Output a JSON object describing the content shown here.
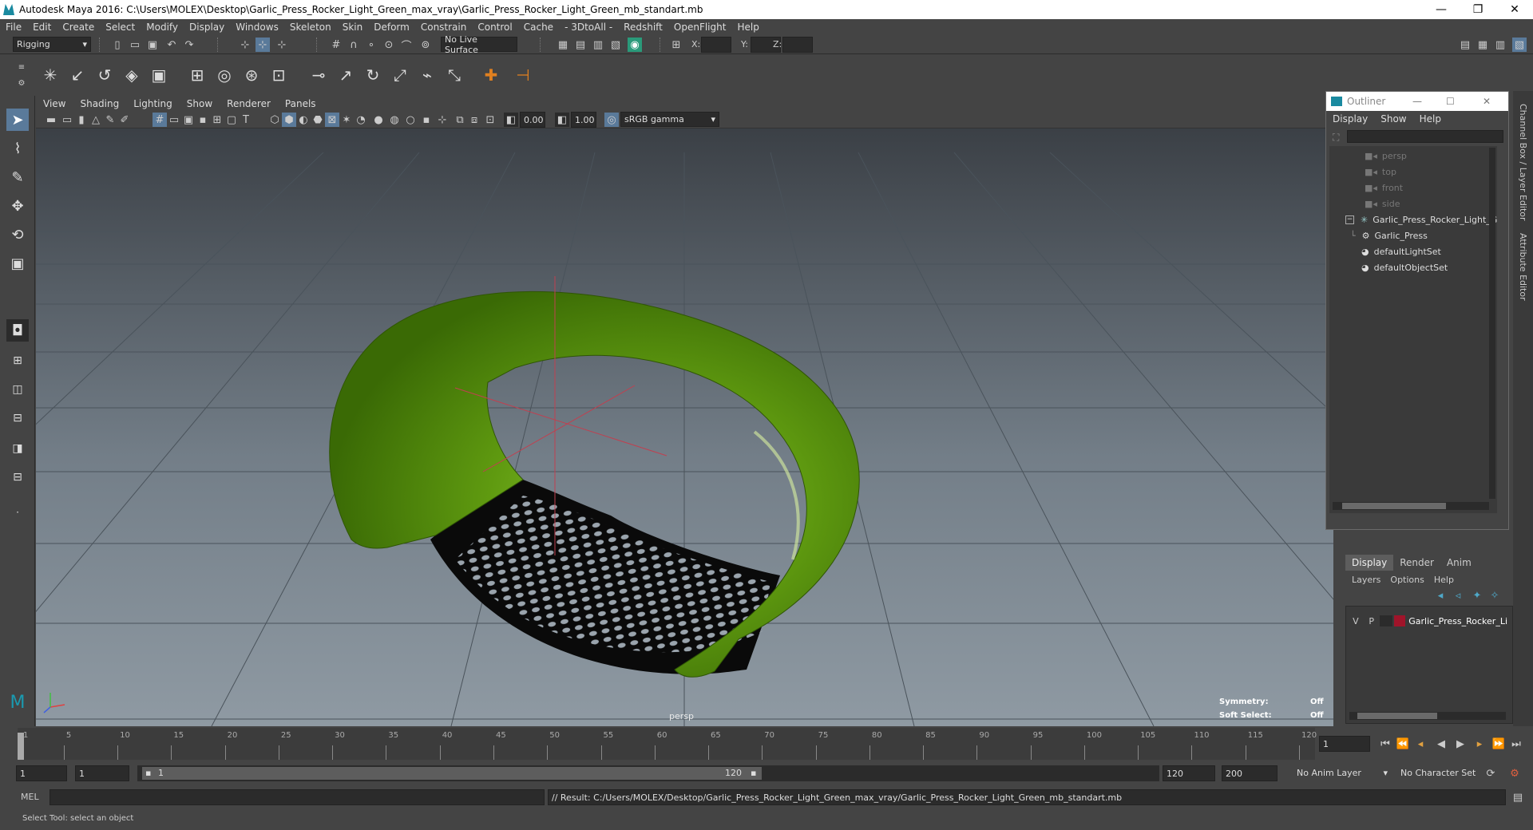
{
  "title_bar": {
    "title": "Autodesk Maya 2016: C:\\Users\\MOLEX\\Desktop\\Garlic_Press_Rocker_Light_Green_max_vray\\Garlic_Press_Rocker_Light_Green_mb_standart.mb",
    "minimize": "—",
    "restore": "❐",
    "close": "✕"
  },
  "menubar": [
    "File",
    "Edit",
    "Create",
    "Select",
    "Modify",
    "Display",
    "Windows",
    "Skeleton",
    "Skin",
    "Deform",
    "Constrain",
    "Control",
    "Cache",
    "- 3DtoAll -",
    "Redshift",
    "OpenFlight",
    "Help"
  ],
  "status_line": {
    "mode": "Rigging",
    "live_surface": "No Live Surface",
    "x_label": "X:",
    "y_label": "Y:",
    "z_label": "Z:"
  },
  "viewport": {
    "menu": [
      "View",
      "Shading",
      "Lighting",
      "Show",
      "Renderer",
      "Panels"
    ],
    "exposure": "0.00",
    "gamma": "1.00",
    "color_space": "sRGB gamma",
    "camera_label": "persp",
    "symmetry_label": "Symmetry:",
    "symmetry_value": "Off",
    "soft_select_label": "Soft Select:",
    "soft_select_value": "Off",
    "colors": {
      "object": "#5f9a10",
      "grater": "#0a0a0a"
    }
  },
  "outliner": {
    "title": "Outliner",
    "menu": [
      "Display",
      "Show",
      "Help"
    ],
    "items": [
      {
        "label": "persp",
        "dim": true
      },
      {
        "label": "top",
        "dim": true
      },
      {
        "label": "front",
        "dim": true
      },
      {
        "label": "side",
        "dim": true
      },
      {
        "label": "Garlic_Press_Rocker_Light_G",
        "dim": false
      },
      {
        "label": "Garlic_Press",
        "dim": false
      },
      {
        "label": "defaultLightSet",
        "dim": false
      },
      {
        "label": "defaultObjectSet",
        "dim": false
      }
    ]
  },
  "side_tabs": {
    "channel_box": "Channel Box / Layer Editor",
    "attribute_editor": "Attribute Editor"
  },
  "layer_editor": {
    "tabs": [
      "Display",
      "Render",
      "Anim"
    ],
    "menu": [
      "Layers",
      "Options",
      "Help"
    ],
    "layer": {
      "v": "V",
      "p": "P",
      "name": "Garlic_Press_Rocker_Li",
      "color": "#a0142a"
    }
  },
  "timeline": {
    "ticks": [
      "1",
      "5",
      "10",
      "15",
      "20",
      "25",
      "30",
      "35",
      "40",
      "45",
      "50",
      "55",
      "60",
      "65",
      "70",
      "75",
      "80",
      "85",
      "90",
      "95",
      "100",
      "105",
      "110",
      "115",
      "120"
    ],
    "current_frame": "1"
  },
  "range": {
    "start": "1",
    "playback_start": "1",
    "slider_start": "1",
    "slider_end": "120",
    "playback_end": "120",
    "end": "200",
    "anim_layer": "No Anim Layer",
    "character_set": "No Character Set"
  },
  "command_line": {
    "label": "MEL",
    "result": "// Result: C:/Users/MOLEX/Desktop/Garlic_Press_Rocker_Light_Green_max_vray/Garlic_Press_Rocker_Light_Green_mb_standart.mb"
  },
  "help_line": "Select Tool: select an object"
}
